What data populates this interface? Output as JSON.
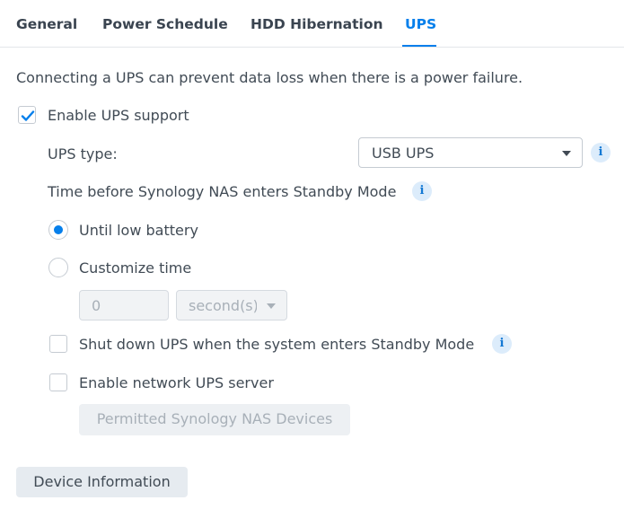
{
  "tabs": [
    {
      "label": "General"
    },
    {
      "label": "Power Schedule"
    },
    {
      "label": "HDD Hibernation"
    },
    {
      "label": "UPS",
      "active": true
    }
  ],
  "description": "Connecting a UPS can prevent data loss when there is a power failure.",
  "enable_ups": {
    "label": "Enable UPS support",
    "checked": true
  },
  "ups_type": {
    "label": "UPS type:",
    "selected": "USB UPS"
  },
  "standby": {
    "heading": "Time before Synology NAS enters Standby Mode",
    "until_low_battery": {
      "label": "Until low battery",
      "selected": true
    },
    "customize_time": {
      "label": "Customize time",
      "selected": false
    },
    "time_value": "0",
    "time_unit": "second(s)"
  },
  "shutdown_ups": {
    "label": "Shut down UPS when the system enters Standby Mode",
    "checked": false
  },
  "network_ups": {
    "label": "Enable network UPS server",
    "checked": false
  },
  "permitted_button": "Permitted Synology NAS Devices",
  "device_info_button": "Device Information",
  "colors": {
    "accent": "#057feb",
    "text": "#414b55",
    "info_bg": "#dcecfb",
    "border": "#c5cbd2"
  },
  "icons": {
    "info": "info-icon",
    "check": "checkmark-icon",
    "dropdown": "chevron-down-icon"
  }
}
